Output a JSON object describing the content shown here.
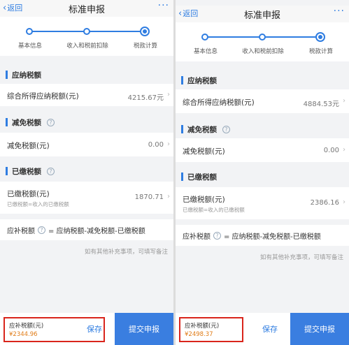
{
  "panels": [
    {
      "nav": {
        "back": "返回",
        "title": "标准申报",
        "more": "···"
      },
      "steps": [
        "基本信息",
        "收入和税前扣除",
        "税款计算"
      ],
      "sections": {
        "payable": {
          "title": "应纳税额",
          "row_label": "综合所得应纳税额(元)",
          "row_value": "4215.67元"
        },
        "reduction": {
          "title": "减免税额",
          "row_label": "减免税额(元)",
          "row_value": "0.00"
        },
        "paid": {
          "title": "已缴税额",
          "row_label": "已缴税额(元)",
          "row_sub": "已缴税额=收入的已缴税额",
          "row_value": "1870.71"
        }
      },
      "formula": {
        "label": "应补税额",
        "text": "= 应纳税额-减免税额-已缴税额"
      },
      "note": "如有其他补充事项，可填写备注",
      "bottom": {
        "amount_label": "应补税额(元)",
        "amount": "¥2344.96",
        "save": "保存",
        "submit": "提交申报"
      }
    },
    {
      "nav": {
        "back": "返回",
        "title": "标准申报",
        "more": "···"
      },
      "steps": [
        "基本信息",
        "收入和税前扣除",
        "税款计算"
      ],
      "sections": {
        "payable": {
          "title": "应纳税额",
          "row_label": "综合所得应纳税额(元)",
          "row_value": "4884.53元"
        },
        "reduction": {
          "title": "减免税额",
          "row_label": "减免税额(元)",
          "row_value": "0.00"
        },
        "paid": {
          "title": "已缴税额",
          "row_label": "已缴税额(元)",
          "row_sub": "已缴税额=收入的已缴税额",
          "row_value": "2386.16"
        }
      },
      "formula": {
        "label": "应补税额",
        "text": "= 应纳税额-减免税额-已缴税额"
      },
      "note": "如有其他补充事项，可填写备注",
      "bottom": {
        "amount_label": "应补税额(元)",
        "amount": "¥2498.37",
        "save": "保存",
        "submit": "提交申报"
      }
    }
  ],
  "colors": {
    "accent": "#2f7de1",
    "highlight_border": "#d9251c",
    "amount": "#e07b16"
  }
}
